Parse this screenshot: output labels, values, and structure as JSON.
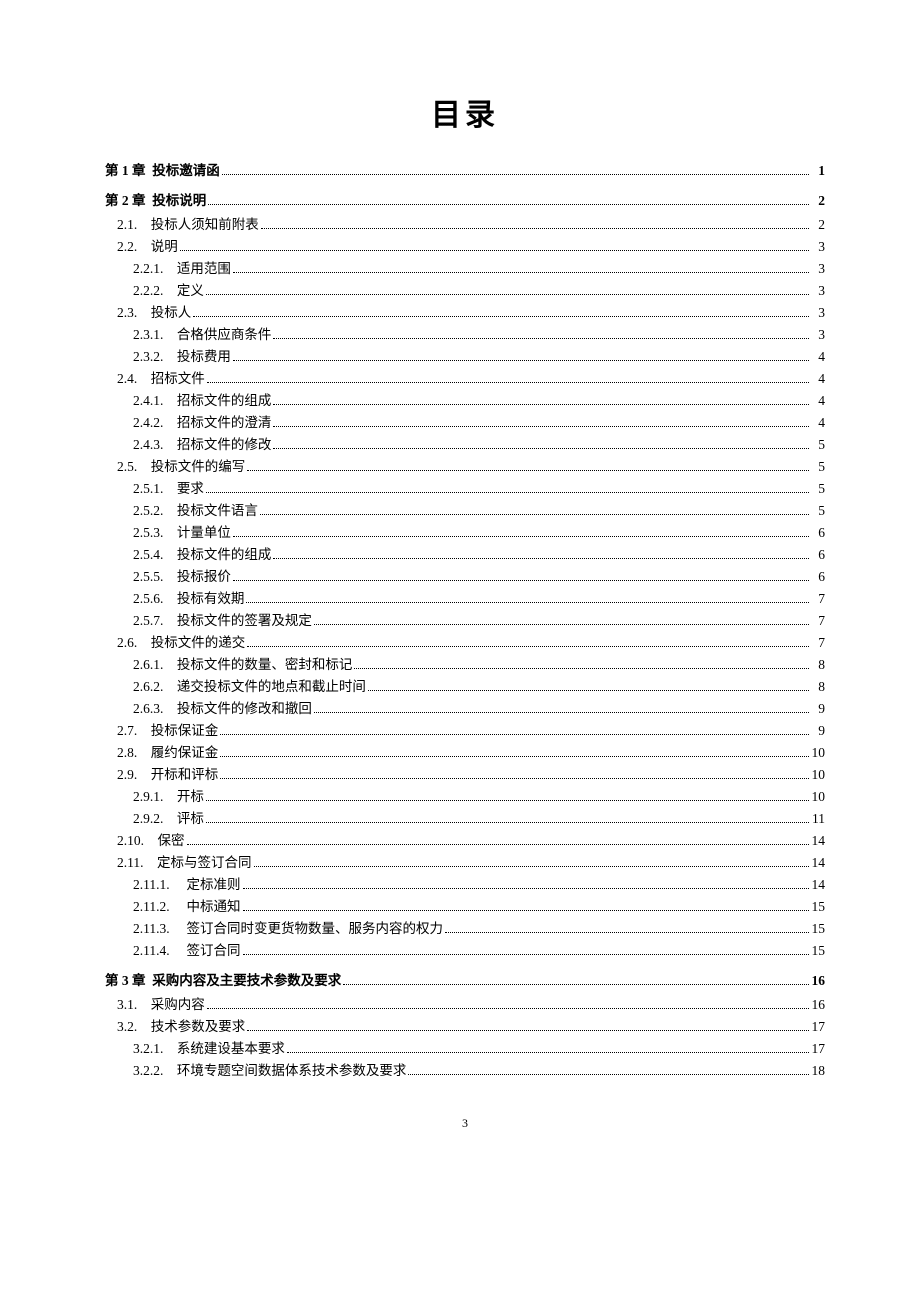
{
  "title": "目录",
  "page_number": "3",
  "toc": [
    {
      "level": 0,
      "num": "第 1 章",
      "gap": "  ",
      "text": "投标邀请函",
      "page": "1"
    },
    {
      "level": 0,
      "num": "第 2 章",
      "gap": "  ",
      "text": "投标说明",
      "page": "2"
    },
    {
      "level": 1,
      "num": "2.1.",
      "gap": "    ",
      "text": "投标人须知前附表",
      "page": "2"
    },
    {
      "level": 1,
      "num": "2.2.",
      "gap": "    ",
      "text": "说明",
      "page": "3"
    },
    {
      "level": 2,
      "num": "2.2.1.",
      "gap": "    ",
      "text": "适用范围",
      "page": "3"
    },
    {
      "level": 2,
      "num": "2.2.2.",
      "gap": "    ",
      "text": "定义",
      "page": "3"
    },
    {
      "level": 1,
      "num": "2.3.",
      "gap": "    ",
      "text": "投标人",
      "page": "3"
    },
    {
      "level": 2,
      "num": "2.3.1.",
      "gap": "    ",
      "text": "合格供应商条件",
      "page": "3"
    },
    {
      "level": 2,
      "num": "2.3.2.",
      "gap": "    ",
      "text": "投标费用",
      "page": "4"
    },
    {
      "level": 1,
      "num": "2.4.",
      "gap": "    ",
      "text": "招标文件",
      "page": "4"
    },
    {
      "level": 2,
      "num": "2.4.1.",
      "gap": "    ",
      "text": "招标文件的组成",
      "page": "4"
    },
    {
      "level": 2,
      "num": "2.4.2.",
      "gap": "    ",
      "text": "招标文件的澄清",
      "page": "4"
    },
    {
      "level": 2,
      "num": "2.4.3.",
      "gap": "    ",
      "text": "招标文件的修改",
      "page": "5"
    },
    {
      "level": 1,
      "num": "2.5.",
      "gap": "    ",
      "text": "投标文件的编写",
      "page": "5"
    },
    {
      "level": 2,
      "num": "2.5.1.",
      "gap": "    ",
      "text": "要求",
      "page": "5"
    },
    {
      "level": 2,
      "num": "2.5.2.",
      "gap": "    ",
      "text": "投标文件语言",
      "page": "5"
    },
    {
      "level": 2,
      "num": "2.5.3.",
      "gap": "    ",
      "text": "计量单位",
      "page": "6"
    },
    {
      "level": 2,
      "num": "2.5.4.",
      "gap": "    ",
      "text": "投标文件的组成",
      "page": "6"
    },
    {
      "level": 2,
      "num": "2.5.5.",
      "gap": "    ",
      "text": "投标报价",
      "page": "6"
    },
    {
      "level": 2,
      "num": "2.5.6.",
      "gap": "    ",
      "text": "投标有效期",
      "page": "7"
    },
    {
      "level": 2,
      "num": "2.5.7.",
      "gap": "    ",
      "text": "投标文件的签署及规定",
      "page": "7"
    },
    {
      "level": 1,
      "num": "2.6.",
      "gap": "    ",
      "text": "投标文件的递交",
      "page": "7"
    },
    {
      "level": 2,
      "num": "2.6.1.",
      "gap": "    ",
      "text": "投标文件的数量、密封和标记",
      "page": "8"
    },
    {
      "level": 2,
      "num": "2.6.2.",
      "gap": "    ",
      "text": "递交投标文件的地点和截止时间",
      "page": "8"
    },
    {
      "level": 2,
      "num": "2.6.3.",
      "gap": "    ",
      "text": "投标文件的修改和撤回",
      "page": "9"
    },
    {
      "level": 1,
      "num": "2.7.",
      "gap": "    ",
      "text": "投标保证金",
      "page": "9"
    },
    {
      "level": 1,
      "num": "2.8.",
      "gap": "    ",
      "text": "履约保证金",
      "page": "10"
    },
    {
      "level": 1,
      "num": "2.9.",
      "gap": "    ",
      "text": "开标和评标",
      "page": "10"
    },
    {
      "level": 2,
      "num": "2.9.1.",
      "gap": "    ",
      "text": "开标",
      "page": "10"
    },
    {
      "level": 2,
      "num": "2.9.2.",
      "gap": "    ",
      "text": "评标",
      "page": "11"
    },
    {
      "level": 1,
      "num": "2.10.",
      "gap": "    ",
      "text": "保密",
      "page": "14"
    },
    {
      "level": 1,
      "num": "2.11.",
      "gap": "    ",
      "text": "定标与签订合同",
      "page": "14"
    },
    {
      "level": 2,
      "num": "2.11.1.",
      "gap": "     ",
      "text": "定标准则",
      "page": "14"
    },
    {
      "level": 2,
      "num": "2.11.2.",
      "gap": "     ",
      "text": "中标通知",
      "page": "15"
    },
    {
      "level": 2,
      "num": "2.11.3.",
      "gap": "     ",
      "text": "签订合同时变更货物数量、服务内容的权力",
      "page": "15"
    },
    {
      "level": 2,
      "num": "2.11.4.",
      "gap": "     ",
      "text": "签订合同",
      "page": "15"
    },
    {
      "level": 0,
      "num": "第 3 章",
      "gap": "  ",
      "text": "采购内容及主要技术参数及要求",
      "page": "16"
    },
    {
      "level": 1,
      "num": "3.1.",
      "gap": "    ",
      "text": "采购内容",
      "page": "16"
    },
    {
      "level": 1,
      "num": "3.2.",
      "gap": "    ",
      "text": "技术参数及要求",
      "page": "17"
    },
    {
      "level": 2,
      "num": "3.2.1.",
      "gap": "    ",
      "text": "系统建设基本要求",
      "page": "17"
    },
    {
      "level": 2,
      "num": "3.2.2.",
      "gap": "    ",
      "text": "环境专题空间数据体系技术参数及要求",
      "page": "18"
    }
  ]
}
